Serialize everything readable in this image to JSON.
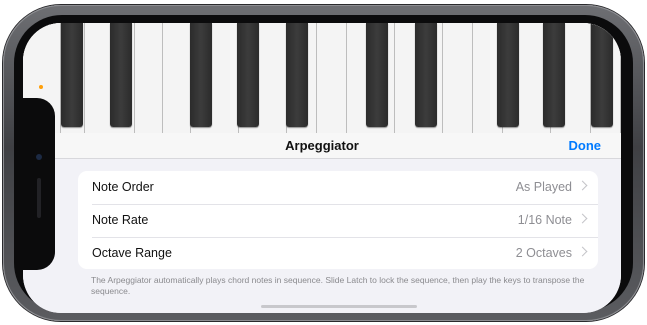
{
  "nav": {
    "title": "Arpeggiator",
    "done_label": "Done"
  },
  "settings": [
    {
      "label": "Note Order",
      "value": "As Played"
    },
    {
      "label": "Note Rate",
      "value": "1/16 Note"
    },
    {
      "label": "Octave Range",
      "value": "2 Octaves"
    }
  ],
  "footer_text": "The Arpeggiator automatically plays chord notes in sequence. Slide Latch to lock the sequence, then play the keys to transpose the sequence.",
  "colors": {
    "accent": "#007aff",
    "status_dot": "#ff9f0a",
    "black_key": "#2b2b2b",
    "white_key": "#f4f4f4"
  }
}
